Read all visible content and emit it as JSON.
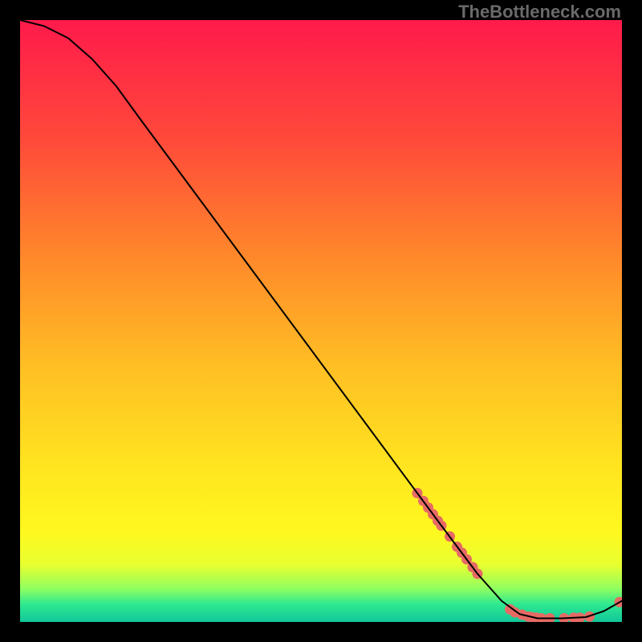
{
  "watermark": "TheBottleneck.com",
  "colors": {
    "marker_fill": "#e66a64",
    "marker_stroke": "#b04a45",
    "curve": "#000000",
    "gradient_stops": [
      {
        "offset": 0.0,
        "color": "#ff1a4b"
      },
      {
        "offset": 0.2,
        "color": "#ff4a3a"
      },
      {
        "offset": 0.4,
        "color": "#ff8a2a"
      },
      {
        "offset": 0.58,
        "color": "#ffc024"
      },
      {
        "offset": 0.75,
        "color": "#ffe61f"
      },
      {
        "offset": 0.85,
        "color": "#fff81f"
      },
      {
        "offset": 0.905,
        "color": "#e8ff30"
      },
      {
        "offset": 0.945,
        "color": "#8fff60"
      },
      {
        "offset": 0.97,
        "color": "#30e98f"
      },
      {
        "offset": 1.0,
        "color": "#10c79a"
      }
    ]
  },
  "chart_data": {
    "type": "line",
    "title": "",
    "xlabel": "",
    "ylabel": "",
    "xlim": [
      0,
      100
    ],
    "ylim": [
      0,
      100
    ],
    "grid": false,
    "curve": [
      {
        "x": 0,
        "y": 100.0
      },
      {
        "x": 4,
        "y": 99.0
      },
      {
        "x": 8,
        "y": 97.0
      },
      {
        "x": 12,
        "y": 93.5
      },
      {
        "x": 16,
        "y": 89.0
      },
      {
        "x": 20,
        "y": 83.5
      },
      {
        "x": 30,
        "y": 70.0
      },
      {
        "x": 40,
        "y": 56.5
      },
      {
        "x": 50,
        "y": 43.0
      },
      {
        "x": 60,
        "y": 29.5
      },
      {
        "x": 70,
        "y": 16.0
      },
      {
        "x": 76,
        "y": 8.0
      },
      {
        "x": 80,
        "y": 3.5
      },
      {
        "x": 83,
        "y": 1.3
      },
      {
        "x": 86,
        "y": 0.6
      },
      {
        "x": 90,
        "y": 0.6
      },
      {
        "x": 94,
        "y": 0.8
      },
      {
        "x": 97,
        "y": 1.8
      },
      {
        "x": 100,
        "y": 3.5
      }
    ],
    "markers": [
      {
        "x": 66.0,
        "y": 21.4
      },
      {
        "x": 67.0,
        "y": 20.1
      },
      {
        "x": 67.8,
        "y": 19.0
      },
      {
        "x": 68.6,
        "y": 17.9
      },
      {
        "x": 69.4,
        "y": 16.8
      },
      {
        "x": 70.0,
        "y": 16.0
      },
      {
        "x": 71.4,
        "y": 14.2
      },
      {
        "x": 72.6,
        "y": 12.5
      },
      {
        "x": 73.4,
        "y": 11.5
      },
      {
        "x": 74.2,
        "y": 10.4
      },
      {
        "x": 75.2,
        "y": 9.1
      },
      {
        "x": 76.0,
        "y": 8.0
      },
      {
        "x": 81.4,
        "y": 2.1
      },
      {
        "x": 82.2,
        "y": 1.6
      },
      {
        "x": 83.4,
        "y": 1.2
      },
      {
        "x": 84.4,
        "y": 0.9
      },
      {
        "x": 85.0,
        "y": 0.8
      },
      {
        "x": 85.8,
        "y": 0.7
      },
      {
        "x": 86.6,
        "y": 0.6
      },
      {
        "x": 88.0,
        "y": 0.6
      },
      {
        "x": 90.4,
        "y": 0.6
      },
      {
        "x": 92.0,
        "y": 0.7
      },
      {
        "x": 93.0,
        "y": 0.7
      },
      {
        "x": 94.6,
        "y": 0.9
      },
      {
        "x": 99.6,
        "y": 3.3
      }
    ]
  }
}
